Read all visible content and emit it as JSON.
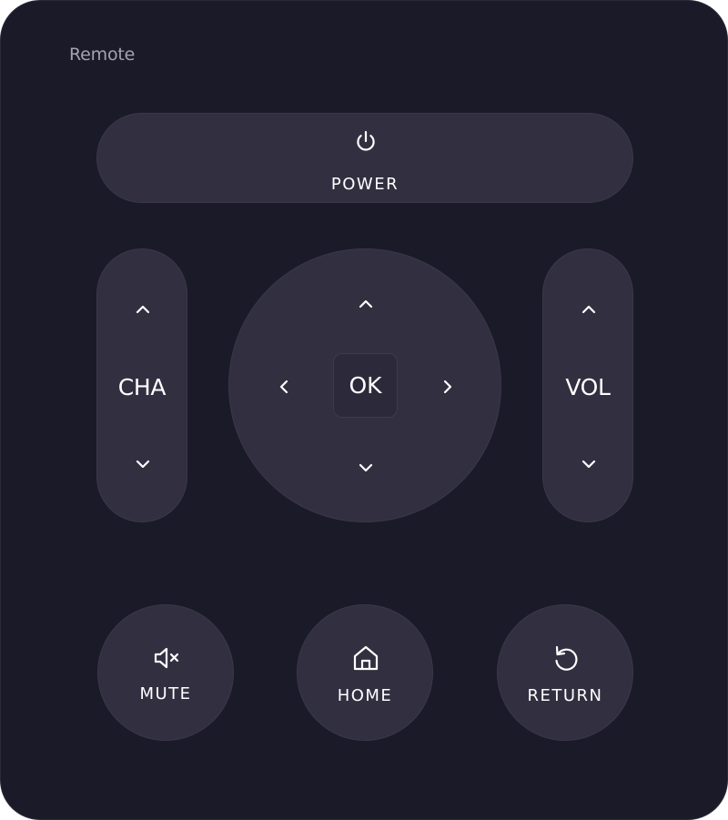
{
  "title": "Remote",
  "power": {
    "label": "POWER",
    "icon": "power-icon"
  },
  "channel": {
    "label": "CHA",
    "up_icon": "chevron-up-icon",
    "down_icon": "chevron-down-icon"
  },
  "volume": {
    "label": "VOL",
    "up_icon": "chevron-up-icon",
    "down_icon": "chevron-down-icon"
  },
  "dpad": {
    "ok_label": "OK"
  },
  "mute": {
    "label": "MUTE",
    "icon": "volume-mute-icon"
  },
  "home": {
    "label": "HOME",
    "icon": "home-icon"
  },
  "return": {
    "label": "RETURN",
    "icon": "return-icon"
  },
  "colors": {
    "background": "#1b1a29",
    "button": "#322f40",
    "text": "#ffffff",
    "title": "#a4a3b0"
  }
}
